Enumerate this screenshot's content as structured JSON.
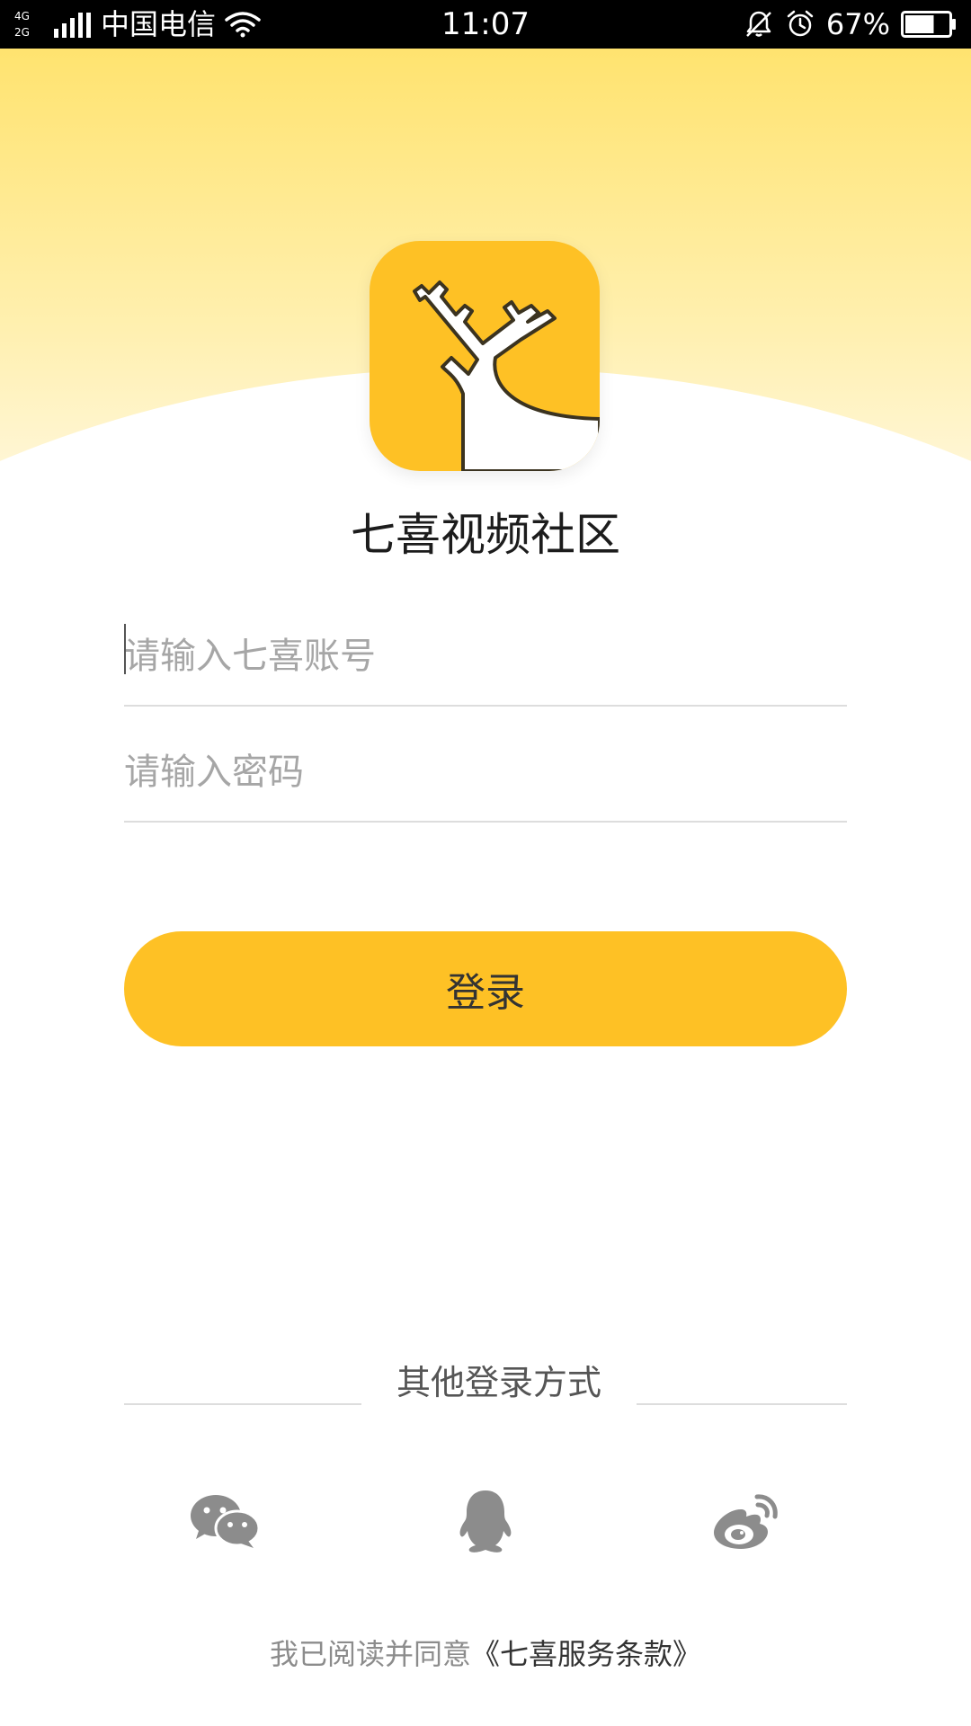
{
  "status_bar": {
    "network_top": "4G",
    "network_bottom": "2G",
    "carrier": "中国电信",
    "time": "11:07",
    "battery_percent": "67%",
    "battery_level": 0.67
  },
  "app": {
    "name": "七喜视频社区",
    "brand_color": "#fec125"
  },
  "login_form": {
    "account_placeholder": "请输入七喜账号",
    "password_placeholder": "请输入密码",
    "login_label": "登录"
  },
  "other_login": {
    "label": "其他登录方式",
    "methods": [
      {
        "icon": "wechat-icon"
      },
      {
        "icon": "qq-icon"
      },
      {
        "icon": "weibo-icon"
      }
    ]
  },
  "agreement": {
    "prefix": "我已阅读并同意",
    "link": "《七喜服务条款》"
  }
}
